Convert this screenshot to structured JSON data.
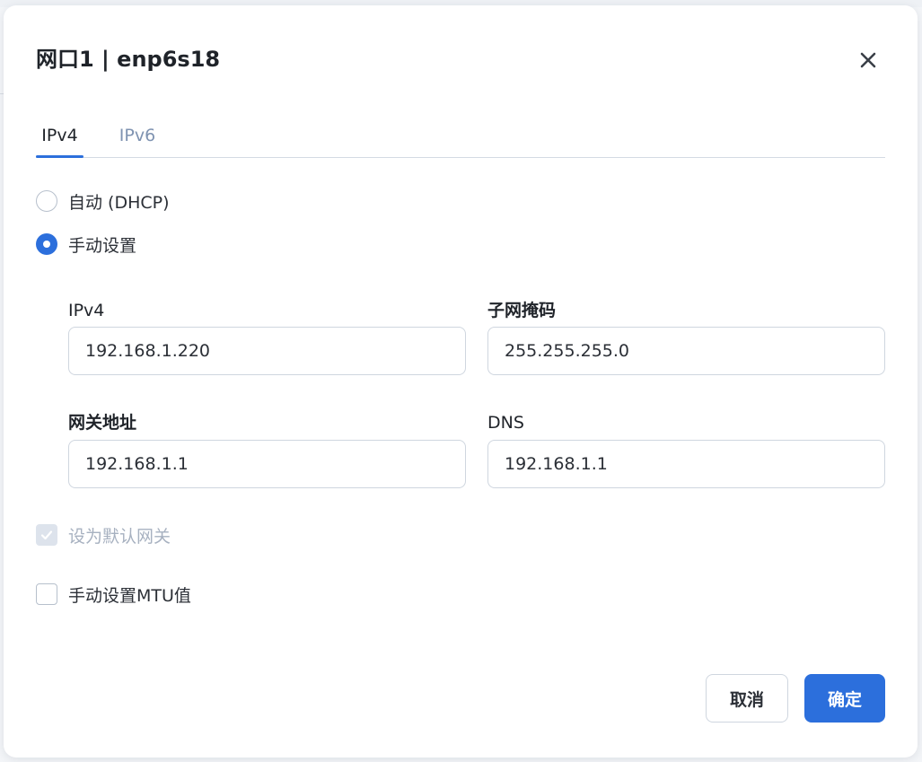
{
  "dialog": {
    "title": "网口1 | enp6s18",
    "close_icon": "close-icon"
  },
  "tabs": [
    {
      "label": "IPv4",
      "active": true
    },
    {
      "label": "IPv6",
      "active": false
    }
  ],
  "mode": {
    "options": [
      {
        "label": "自动 (DHCP)",
        "checked": false
      },
      {
        "label": "手动设置",
        "checked": true
      }
    ]
  },
  "fields": {
    "ipv4": {
      "label": "IPv4",
      "value": "192.168.1.220"
    },
    "netmask": {
      "label": "子网掩码",
      "value": "255.255.255.0"
    },
    "gateway": {
      "label": "网关地址",
      "value": "192.168.1.1"
    },
    "dns": {
      "label": "DNS",
      "value": "192.168.1.1"
    }
  },
  "options": {
    "default_gateway": {
      "label": "设为默认网关",
      "checked": true,
      "disabled": true
    },
    "manual_mtu": {
      "label": "手动设置MTU值",
      "checked": false
    }
  },
  "buttons": {
    "cancel": "取消",
    "confirm": "确定"
  },
  "colors": {
    "accent": "#2c6fdc",
    "inactive_tab": "#7f93b1",
    "disabled_text": "#a7b1c0"
  }
}
